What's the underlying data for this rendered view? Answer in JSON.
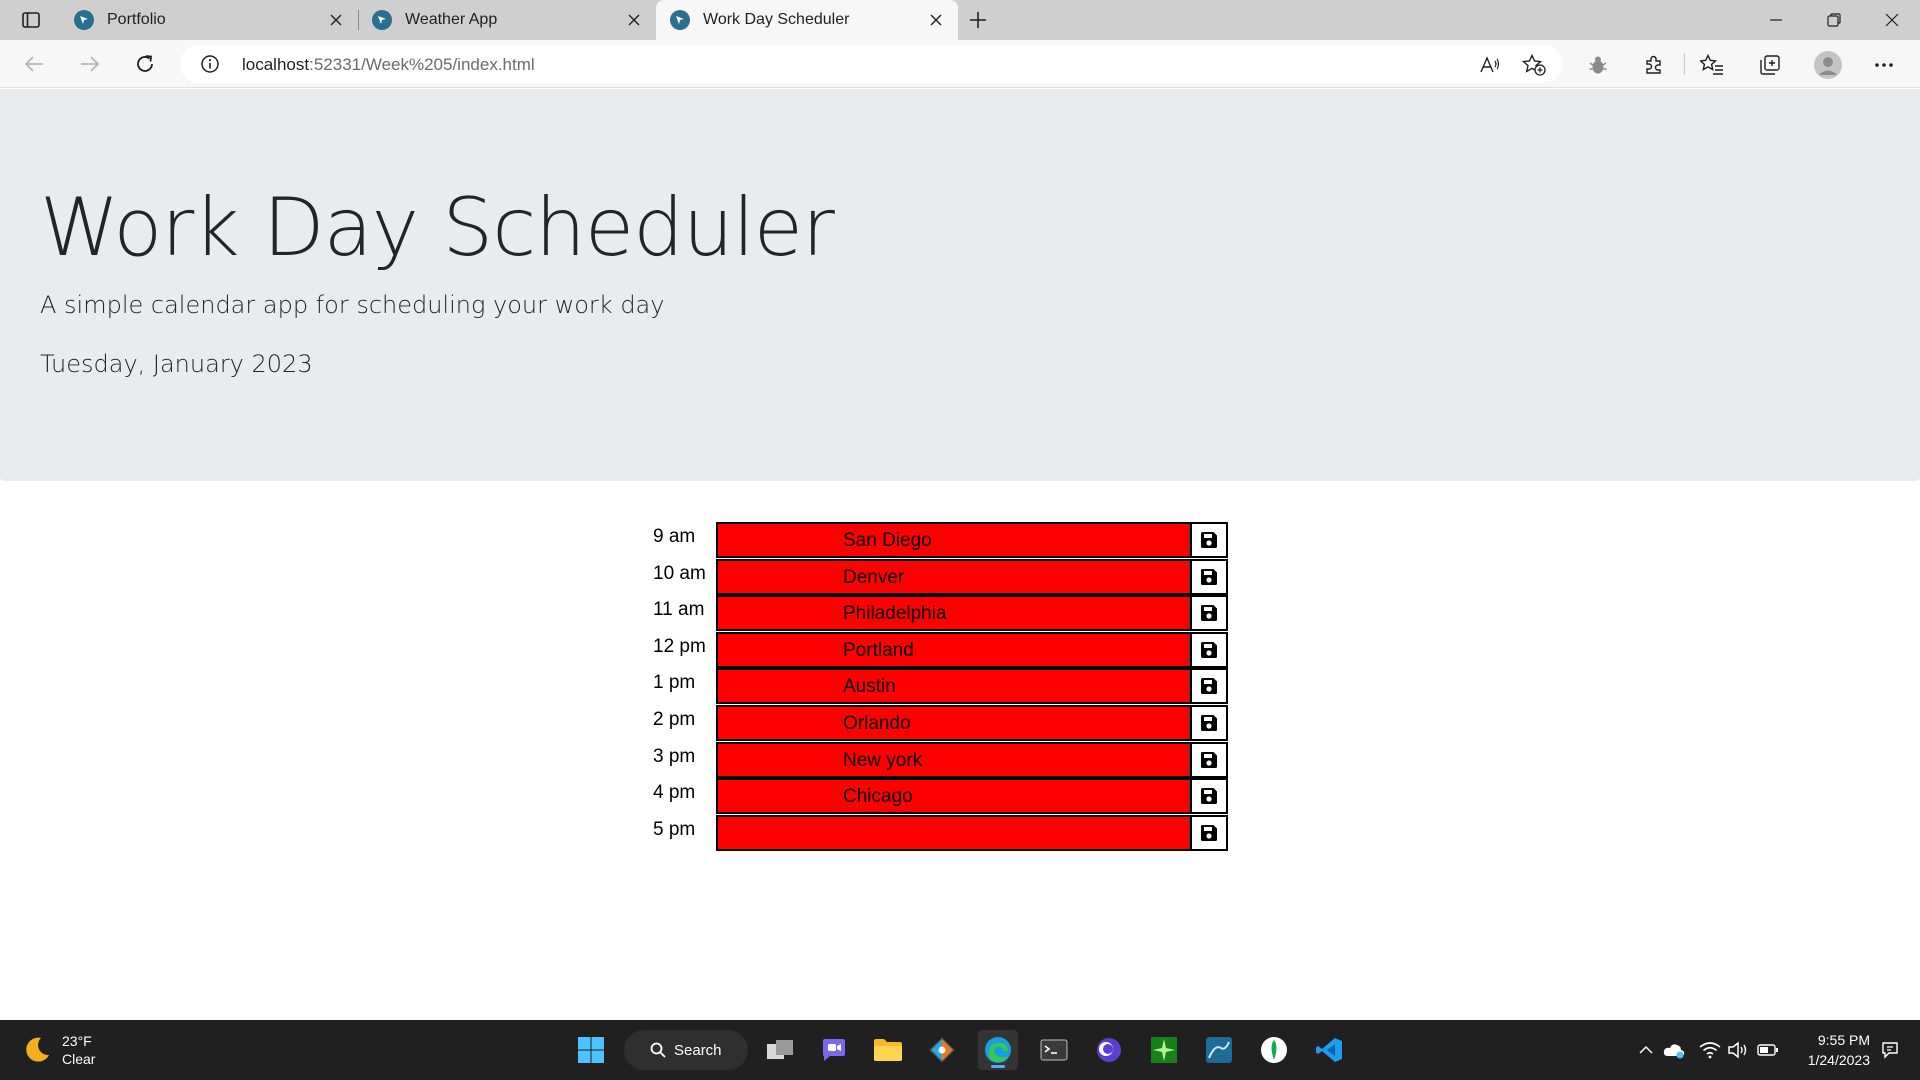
{
  "browser": {
    "tabs": [
      {
        "title": "Portfolio",
        "active": false
      },
      {
        "title": "Weather App",
        "active": false
      },
      {
        "title": "Work Day Scheduler",
        "active": true
      }
    ],
    "address": {
      "host": "localhost",
      "rest": ":52331/Week%205/index.html"
    }
  },
  "page": {
    "title": "Work Day Scheduler",
    "subtitle": "A simple calendar app for scheduling your work day",
    "current_day": "Tuesday, January 2023",
    "past_color": "#ff0000",
    "rows": [
      {
        "hour": "9 am",
        "text": "San Diego"
      },
      {
        "hour": "10 am",
        "text": "Denver"
      },
      {
        "hour": "11 am",
        "text": "Philadelphia"
      },
      {
        "hour": "12 pm",
        "text": "Portland"
      },
      {
        "hour": "1 pm",
        "text": "Austin"
      },
      {
        "hour": "2 pm",
        "text": "Orlando"
      },
      {
        "hour": "3 pm",
        "text": "New york"
      },
      {
        "hour": "4 pm",
        "text": "Chicago"
      },
      {
        "hour": "5 pm",
        "text": ""
      }
    ]
  },
  "taskbar": {
    "weather": {
      "temp": "23°F",
      "condition": "Clear"
    },
    "search_label": "Search",
    "clock": {
      "time": "9:55 PM",
      "date": "1/24/2023"
    }
  }
}
